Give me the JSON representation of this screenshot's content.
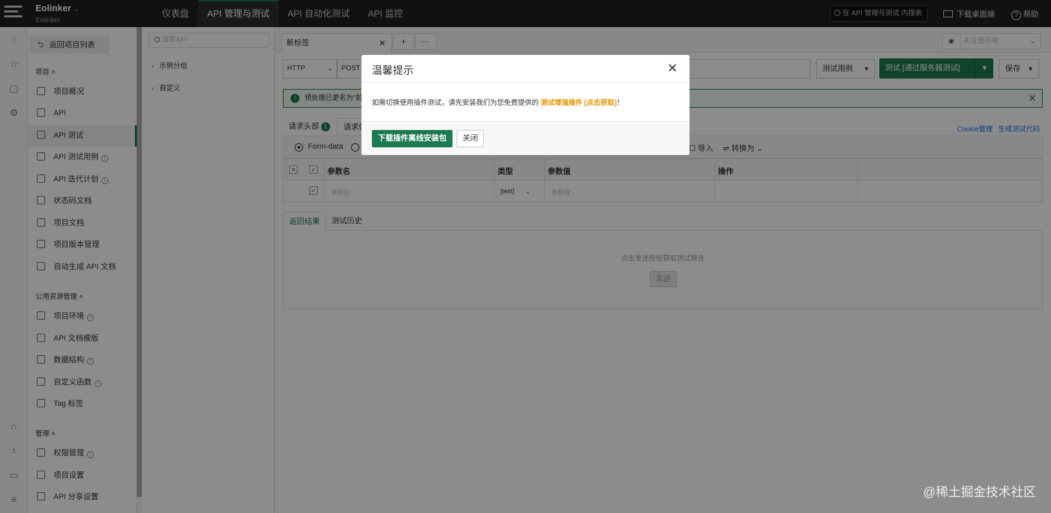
{
  "topbar": {
    "brand_name": "Eolinker",
    "brand_sub": "Eolinker",
    "nav": [
      "仪表盘",
      "API 管理与测试",
      "API 自动化测试",
      "API 监控"
    ],
    "active_nav": 1,
    "search_placeholder": "在 API 管理与测试 内搜索",
    "download_label": "下载桌面端",
    "help_label": "帮助"
  },
  "sidebar": {
    "back_label": "返回项目列表",
    "section_project": "项目",
    "project_items": [
      "项目概况",
      "API",
      "API 测试",
      "API 测试用例",
      "API 迭代计划",
      "状态码文档",
      "项目文档",
      "项目版本管理",
      "自动生成 API 文档"
    ],
    "section_public": "公用资源管理",
    "public_items": [
      "项目环境",
      "API 文档模版",
      "数据结构",
      "自定义函数",
      "Tag 标签"
    ],
    "section_manage": "管理",
    "manage_items": [
      "权限管理",
      "项目设置",
      "API 分享设置"
    ]
  },
  "tree": {
    "search_placeholder": "搜索API",
    "nodes": [
      "示例分组",
      "自定义"
    ]
  },
  "main": {
    "tab_label": "新标签",
    "env_placeholder": "未设置环境",
    "protocol": "HTTP",
    "method": "POST",
    "cases_label": "测试用例",
    "test_label": "测试 [通过服务器测试]",
    "save_label": "保存",
    "notice_text": "预处理已更名为\"前",
    "param_tabs": [
      "请求头部",
      "请求体"
    ],
    "header_count": "1",
    "cookie_link": "Cookie管理",
    "gen_code_link": "生成测试代码",
    "body_type": "Form-data",
    "import_label": "导入",
    "convert_label": "转换为",
    "table_headers": [
      "参数名",
      "类型",
      "参数值",
      "操作"
    ],
    "row_name_placeholder": "参数名",
    "row_type": "[text]",
    "row_value_placeholder": "参数值",
    "result_tabs": [
      "返回结果",
      "测试历史"
    ],
    "result_hint": "点击发送按钮获取测试报告",
    "send_label": "发送"
  },
  "modal": {
    "title": "温馨提示",
    "body_prefix": "如需切换使用插件测试，请先安装我们为您免费提供的 ",
    "body_highlight": "测试增强插件 [点击获取]",
    "body_suffix": "！",
    "primary_label": "下载插件离线安装包",
    "close_label": "关闭"
  },
  "watermark": "@稀土掘金技术社区",
  "colors": {
    "accent": "#1c7a51",
    "highlight": "#e39500",
    "topbar": "#1f1f1f"
  }
}
